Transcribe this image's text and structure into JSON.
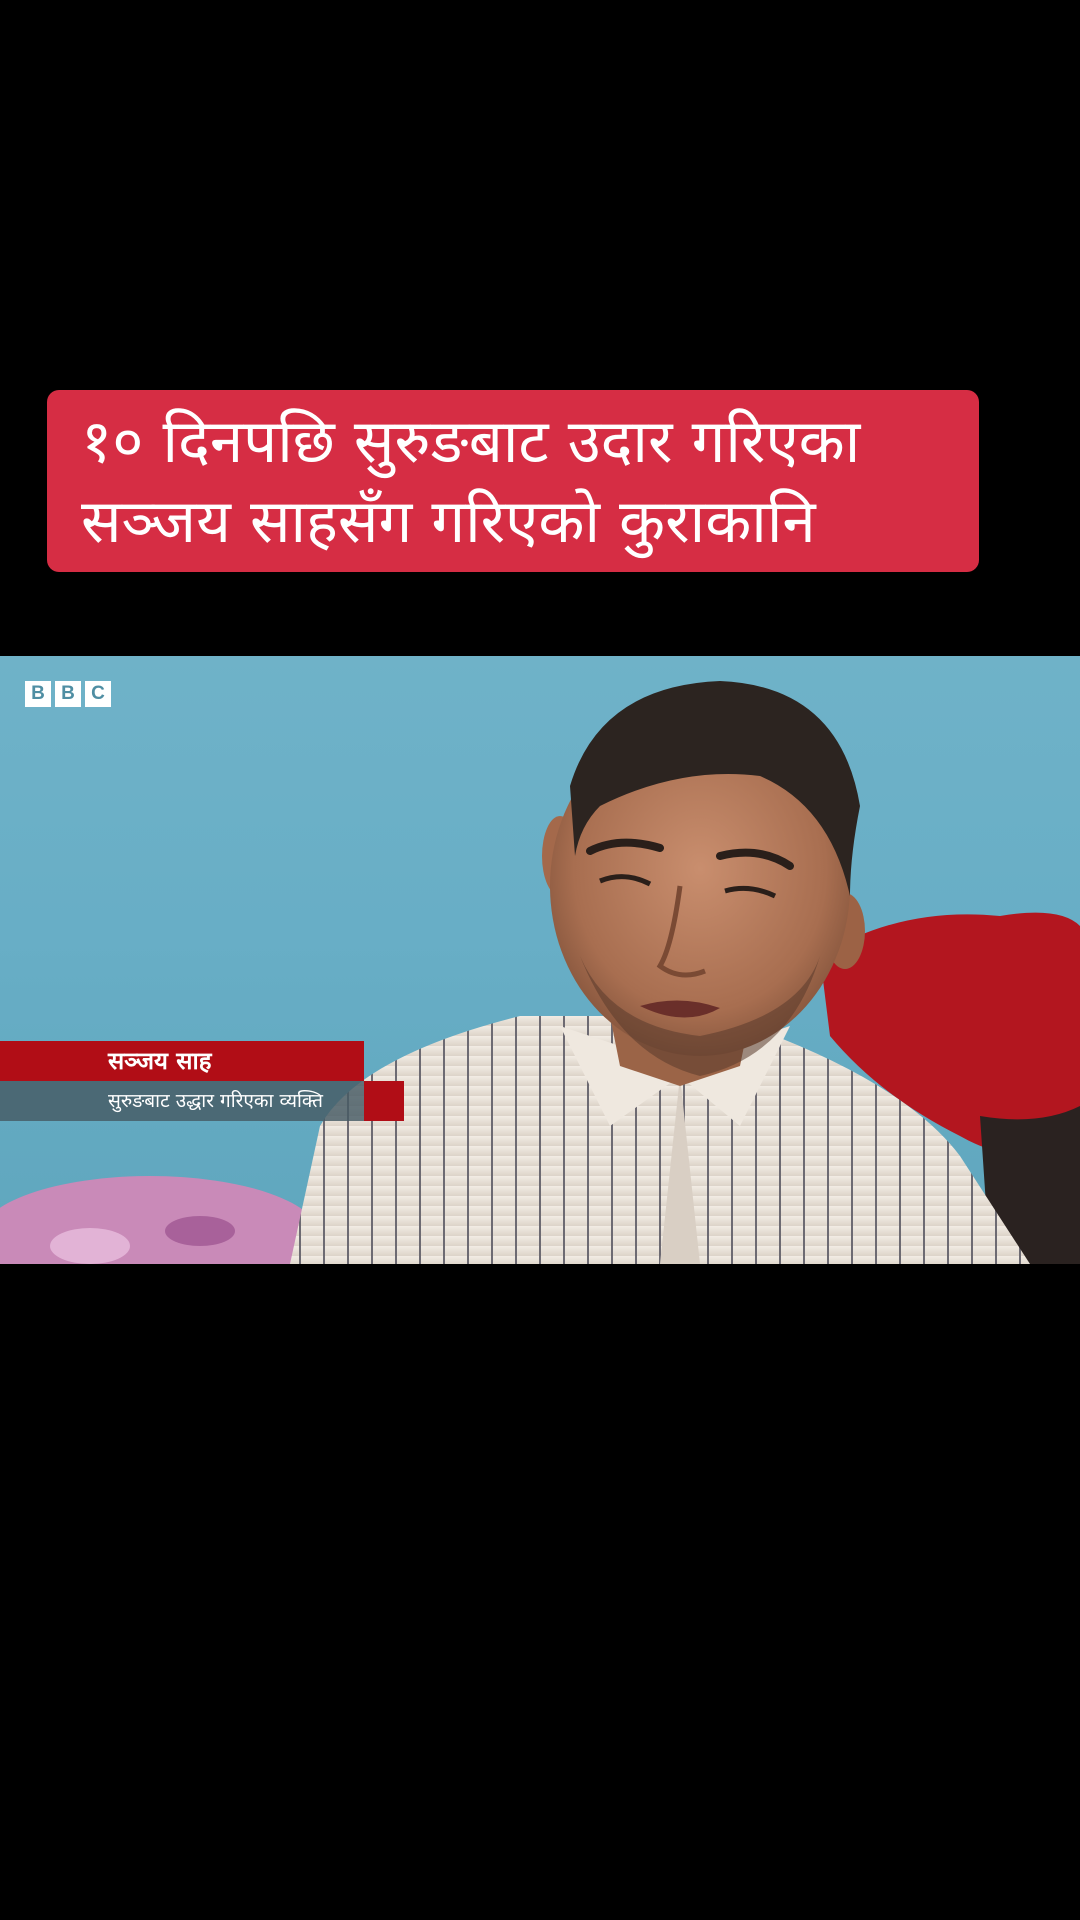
{
  "headline": {
    "line1": "१० दिनपछि सुरुङबाट उदार गरिएका",
    "line2": "सञ्जय साहसँग गरिएको कुराकानि"
  },
  "video": {
    "logo": {
      "letters": [
        "B",
        "B",
        "C"
      ]
    },
    "lower_third": {
      "name": "सञ्जय साह",
      "role": "सुरुङबाट उद्धार गरिएका व्यक्ति"
    }
  },
  "colors": {
    "headline_bg": "#d62d44",
    "lower_third_red": "#b10d16",
    "wall_blue": "#6fb2c8",
    "background": "#000000"
  }
}
